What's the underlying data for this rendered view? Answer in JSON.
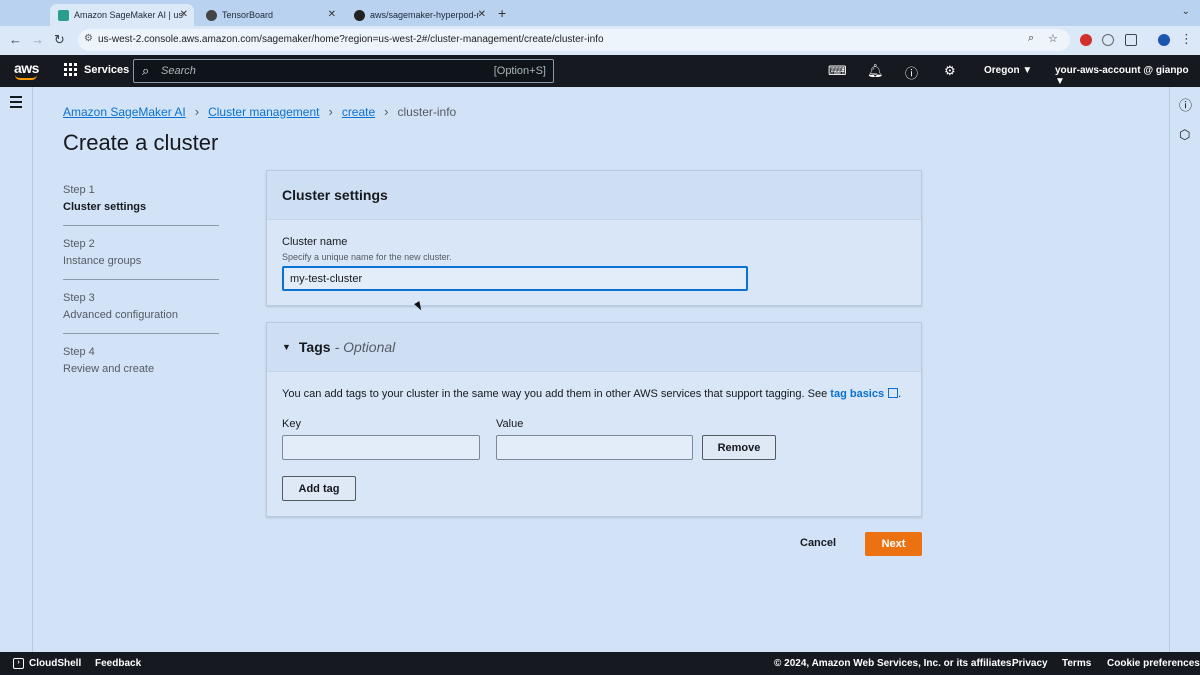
{
  "browser": {
    "tabs": [
      {
        "title": "Amazon SageMaker AI | us-w",
        "active": true
      },
      {
        "title": "TensorBoard",
        "active": false
      },
      {
        "title": "aws/sagemaker-hyperpod-re",
        "active": false
      }
    ],
    "url": "us-west-2.console.aws.amazon.com/sagemaker/home?region=us-west-2#/cluster-management/create/cluster-info"
  },
  "header": {
    "logo": "aws",
    "services_label": "Services",
    "search_placeholder": "Search",
    "search_shortcut": "[Option+S]",
    "region": "Oregon ▼",
    "account": "your-aws-account @ gianpo ▼"
  },
  "breadcrumb": {
    "items": [
      "Amazon SageMaker AI",
      "Cluster management",
      "create"
    ],
    "current": "cluster-info"
  },
  "page": {
    "title": "Create a cluster"
  },
  "steps": [
    {
      "num": "Step 1",
      "name": "Cluster settings",
      "current": true
    },
    {
      "num": "Step 2",
      "name": "Instance groups",
      "current": false
    },
    {
      "num": "Step 3",
      "name": "Advanced configuration",
      "current": false
    },
    {
      "num": "Step 4",
      "name": "Review and create",
      "current": false
    }
  ],
  "cluster_settings": {
    "title": "Cluster settings",
    "name_label": "Cluster name",
    "name_description": "Specify a unique name for the new cluster.",
    "name_value": "my-test-cluster"
  },
  "tags": {
    "title": "Tags",
    "optional": "- Optional",
    "description": "You can add tags to your cluster in the same way you add them in other AWS services that support tagging. See",
    "link": "tag basics",
    "key_label": "Key",
    "value_label": "Value",
    "remove_label": "Remove",
    "add_label": "Add tag"
  },
  "actions": {
    "cancel": "Cancel",
    "next": "Next"
  },
  "footer": {
    "cloudshell": "CloudShell",
    "feedback": "Feedback",
    "copyright": "© 2024, Amazon Web Services, Inc. or its affiliates.",
    "privacy": "Privacy",
    "terms": "Terms",
    "cookies": "Cookie preferences"
  },
  "colors": {
    "accent": "#0972d3",
    "primary_button": "#ec7211",
    "header_bg": "#16191f"
  }
}
